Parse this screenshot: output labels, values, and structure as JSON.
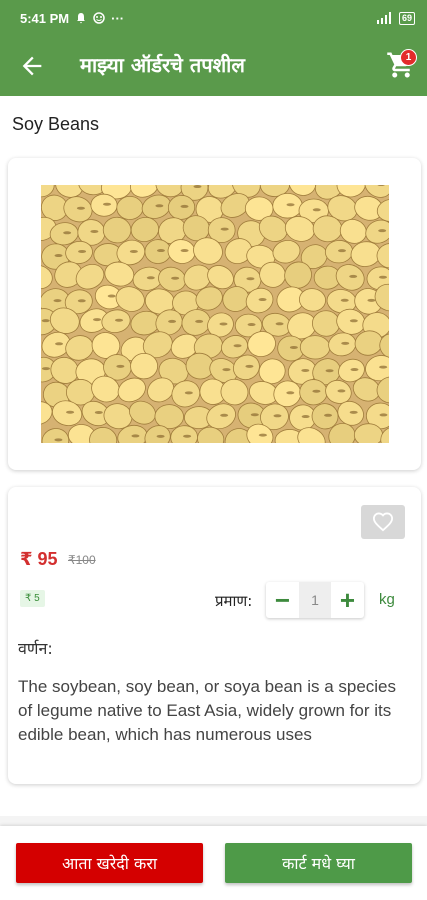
{
  "status_bar": {
    "time": "5:41 PM",
    "icons_left": [
      "bell-icon",
      "emoji-icon",
      "more-dots-icon"
    ],
    "signal": "signal-icon",
    "battery": "69"
  },
  "app_bar": {
    "title": "माझ्या ऑर्डरचे तपशील",
    "cart_count": "1",
    "colors": {
      "primary": "#5a9a4b",
      "badge": "#e32b2b"
    }
  },
  "product": {
    "name": "Soy Beans",
    "image": "soybean-photo",
    "price": "₹ 95",
    "mrp": "₹100",
    "savings": "₹ 5",
    "quantity_label": "प्रमाण:",
    "quantity": "1",
    "unit": "kg",
    "description_label": "वर्णन:",
    "description": "The soybean, soy bean, or soya bean is a species of legume native to East Asia, widely grown for its edible bean, which has numerous uses"
  },
  "actions": {
    "buy_now": "आता खरेदी करा",
    "add_to_cart": "कार्ट मधे घ्या",
    "colors": {
      "buy": "#d40000",
      "cart": "#4e9a48"
    }
  }
}
